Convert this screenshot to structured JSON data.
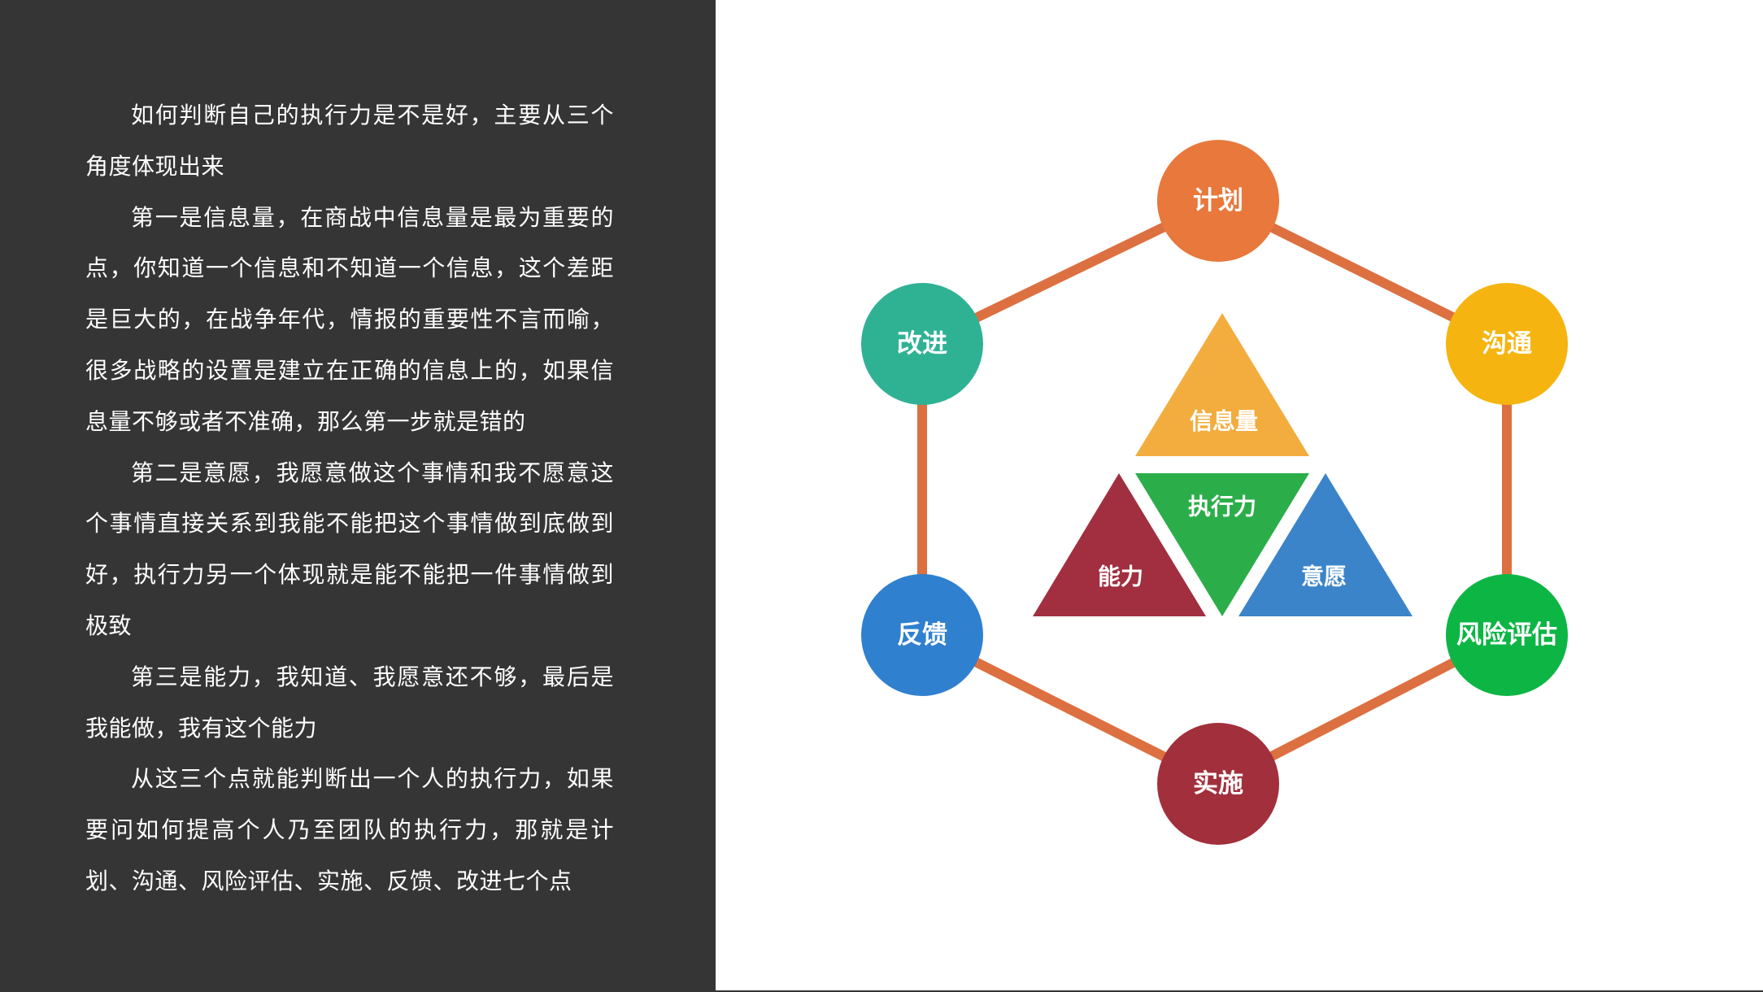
{
  "paragraphs": [
    "如何判断自己的执行力是不是好，主要从三个角度体现出来",
    "第一是信息量，在商战中信息量是最为重要的点，你知道一个信息和不知道一个信息，这个差距是巨大的，在战争年代，情报的重要性不言而喻，很多战略的设置是建立在正确的信息上的，如果信息量不够或者不准确，那么第一步就是错的",
    "第二是意愿，我愿意做这个事情和我不愿意这个事情直接关系到我能不能把这个事情做到底做到好，执行力另一个体现就是能不能把一件事情做到极致",
    "第三是能力，我知道、我愿意还不够，最后是我能做，我有这个能力",
    "从这三个点就能判断出一个人的执行力，如果要问如何提高个人乃至团队的执行力，那就是计划、沟通、风险评估、实施、反馈、改进七个点"
  ],
  "hexagon_nodes": [
    {
      "label": "计划",
      "color": "#E8783C",
      "icon": "circle"
    },
    {
      "label": "沟通",
      "color": "#F5B40F",
      "icon": "circle"
    },
    {
      "label": "风险评估",
      "color": "#0DB545",
      "icon": "circle"
    },
    {
      "label": "实施",
      "color": "#A22F3C",
      "icon": "circle"
    },
    {
      "label": "反馈",
      "color": "#2F80CF",
      "icon": "circle"
    },
    {
      "label": "改进",
      "color": "#2FB294",
      "icon": "circle"
    }
  ],
  "center_triangles": {
    "top": {
      "label": "信息量",
      "color": "#F2AD3E"
    },
    "center": {
      "label": "执行力",
      "color": "#2BAE4A"
    },
    "left": {
      "label": "能力",
      "color": "#A12F3F"
    },
    "right": {
      "label": "意愿",
      "color": "#3B84C9"
    }
  },
  "connector_color": "#DD7040",
  "panel_color": "#353535"
}
